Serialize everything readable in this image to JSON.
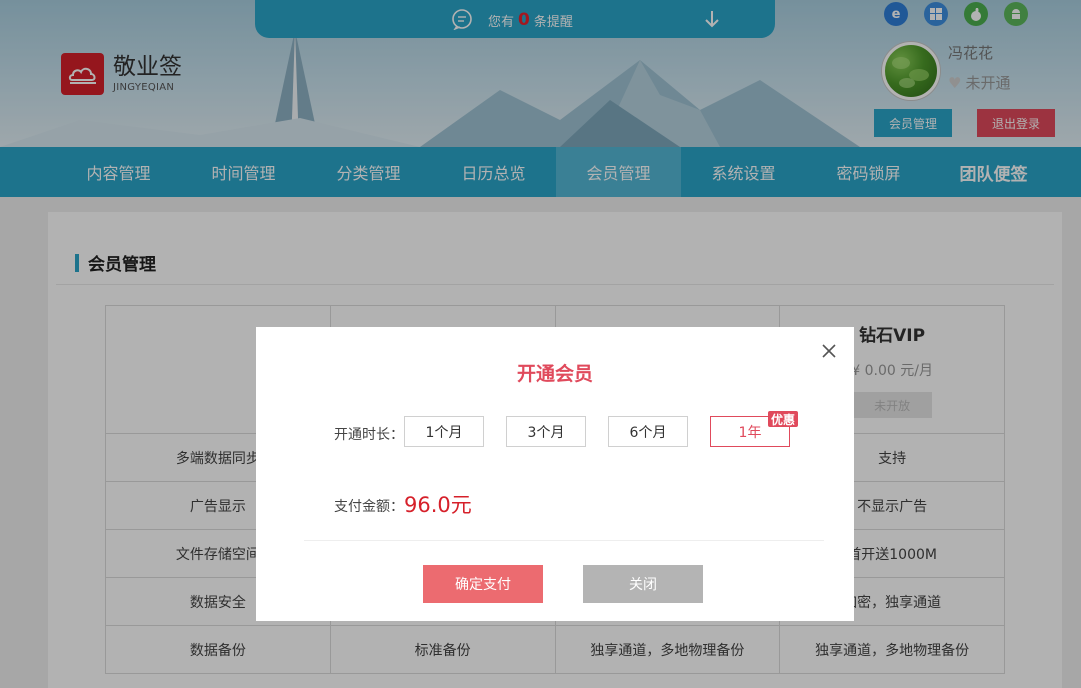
{
  "notice": {
    "prefix": "您有",
    "count": "0",
    "suffix": "条提醒"
  },
  "logo": {
    "cn": "敬业签",
    "en": "JINGYEQIAN"
  },
  "os_icons": [
    "ie-icon",
    "windows-icon",
    "apple-icon",
    "android-icon"
  ],
  "user": {
    "name": "冯花花",
    "status": "未开通",
    "member_btn": "会员管理",
    "logout_btn": "退出登录"
  },
  "nav": {
    "items": [
      "内容管理",
      "时间管理",
      "分类管理",
      "日历总览",
      "会员管理",
      "系统设置",
      "密码锁屏",
      "团队便签"
    ],
    "active": "会员管理"
  },
  "page": {
    "title": "会员管理"
  },
  "table": {
    "header_vip": {
      "title": "钻石VIP",
      "price": "¥ 0.00 元/月",
      "button": "未开放"
    },
    "rows": [
      [
        "多端数据同步",
        "",
        "",
        "支持"
      ],
      [
        "广告显示",
        "",
        "",
        "不显示广告"
      ],
      [
        "文件存储空间",
        "",
        "",
        "首开送1000M"
      ],
      [
        "数据安全",
        "",
        "",
        "加密，独享通道"
      ],
      [
        "数据备份",
        "标准备份",
        "独享通道，多地物理备份",
        "独享通道，多地物理备份"
      ]
    ]
  },
  "modal": {
    "title": "开通会员",
    "duration_label": "开通时长：",
    "durations": [
      "1个月",
      "3个月",
      "6个月",
      "1年"
    ],
    "selected": "1年",
    "badge": "优惠",
    "amount_label": "支付金额：",
    "amount": "96.0元",
    "confirm": "确定支付",
    "cancel": "关闭"
  },
  "colors": {
    "primary": "#2aa5c9",
    "accent": "#e04a5c",
    "price": "#d6202a"
  }
}
